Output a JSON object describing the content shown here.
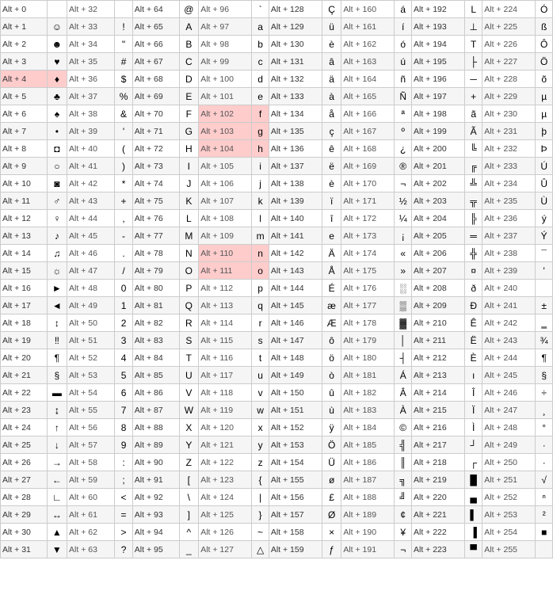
{
  "table": {
    "columns": 8,
    "rows": [
      [
        {
          "code": "Alt + 0",
          "sym": "",
          "alt": "Alt + 32",
          "sym2": " "
        },
        {
          "code": "Alt + 64",
          "sym": "@",
          "alt": "Alt + 96",
          "sym2": "`"
        },
        {
          "code": "Alt + 128",
          "sym": "Ç",
          "alt": "Alt + 160",
          "sym2": "á"
        },
        {
          "code": "Alt + 192",
          "sym": "L",
          "alt": "Alt + 224",
          "sym2": "Ó"
        }
      ],
      [
        {
          "code": "Alt + 1",
          "sym": "☺",
          "alt": "Alt + 33",
          "sym2": "!"
        },
        {
          "code": "Alt + 65",
          "sym": "A",
          "alt": "Alt + 97",
          "sym2": "a"
        },
        {
          "code": "Alt + 129",
          "sym": "ü",
          "alt": "Alt + 161",
          "sym2": "í"
        },
        {
          "code": "Alt + 193",
          "sym": "⊥",
          "alt": "Alt + 225",
          "sym2": "ß"
        }
      ],
      [
        {
          "code": "Alt + 2",
          "sym": "☻",
          "alt": "Alt + 34",
          "sym2": "\""
        },
        {
          "code": "Alt + 66",
          "sym": "B",
          "alt": "Alt + 98",
          "sym2": "b"
        },
        {
          "code": "Alt + 130",
          "sym": "è",
          "alt": "Alt + 162",
          "sym2": "ó"
        },
        {
          "code": "Alt + 194",
          "sym": "T",
          "alt": "Alt + 226",
          "sym2": "Ô"
        }
      ],
      [
        {
          "code": "Alt + 3",
          "sym": "♥",
          "alt": "Alt + 35",
          "sym2": "#"
        },
        {
          "code": "Alt + 67",
          "sym": "C",
          "alt": "Alt + 99",
          "sym2": "c"
        },
        {
          "code": "Alt + 131",
          "sym": "â",
          "alt": "Alt + 163",
          "sym2": "ú"
        },
        {
          "code": "Alt + 195",
          "sym": "├",
          "alt": "Alt + 227",
          "sym2": "Ö"
        }
      ],
      [
        {
          "code": "Alt + 4",
          "sym": "♦",
          "alt": "Alt + 36",
          "sym2": "$"
        },
        {
          "code": "Alt + 68",
          "sym": "D",
          "alt": "Alt + 100",
          "sym2": "d"
        },
        {
          "code": "Alt + 132",
          "sym": "ä",
          "alt": "Alt + 164",
          "sym2": "ñ"
        },
        {
          "code": "Alt + 196",
          "sym": "─",
          "alt": "Alt + 228",
          "sym2": "õ"
        }
      ],
      [
        {
          "code": "Alt + 5",
          "sym": "♣",
          "alt": "Alt + 37",
          "sym2": "%"
        },
        {
          "code": "Alt + 69",
          "sym": "E",
          "alt": "Alt + 101",
          "sym2": "e"
        },
        {
          "code": "Alt + 133",
          "sym": "à",
          "alt": "Alt + 165",
          "sym2": "Ñ"
        },
        {
          "code": "Alt + 197",
          "sym": "+",
          "alt": "Alt + 229",
          "sym2": "µ"
        }
      ],
      [
        {
          "code": "Alt + 6",
          "sym": "♠",
          "alt": "Alt + 38",
          "sym2": "&"
        },
        {
          "code": "Alt + 70",
          "sym": "F",
          "alt": "Alt + 102",
          "sym2": "f"
        },
        {
          "code": "Alt + 134",
          "sym": "å",
          "alt": "Alt + 166",
          "sym2": "ª"
        },
        {
          "code": "Alt + 198",
          "sym": "ã",
          "alt": "Alt + 230",
          "sym2": "µ"
        }
      ],
      [
        {
          "code": "Alt + 7",
          "sym": "•",
          "alt": "Alt + 39",
          "sym2": "'"
        },
        {
          "code": "Alt + 71",
          "sym": "G",
          "alt": "Alt + 103",
          "sym2": "g"
        },
        {
          "code": "Alt + 135",
          "sym": "ç",
          "alt": "Alt + 167",
          "sym2": "º"
        },
        {
          "code": "Alt + 199",
          "sym": "Ã",
          "alt": "Alt + 231",
          "sym2": "þ"
        }
      ],
      [
        {
          "code": "Alt + 8",
          "sym": "◘",
          "alt": "Alt + 40",
          "sym2": "("
        },
        {
          "code": "Alt + 72",
          "sym": "H",
          "alt": "Alt + 104",
          "sym2": "h"
        },
        {
          "code": "Alt + 136",
          "sym": "ê",
          "alt": "Alt + 168",
          "sym2": "¿"
        },
        {
          "code": "Alt + 200",
          "sym": "╚",
          "alt": "Alt + 232",
          "sym2": "Þ"
        }
      ],
      [
        {
          "code": "Alt + 9",
          "sym": "○",
          "alt": "Alt + 41",
          "sym2": ")"
        },
        {
          "code": "Alt + 73",
          "sym": "I",
          "alt": "Alt + 105",
          "sym2": "i"
        },
        {
          "code": "Alt + 137",
          "sym": "ë",
          "alt": "Alt + 169",
          "sym2": "®"
        },
        {
          "code": "Alt + 201",
          "sym": "╔",
          "alt": "Alt + 233",
          "sym2": "Ú"
        }
      ],
      [
        {
          "code": "Alt + 10",
          "sym": "◙",
          "alt": "Alt + 42",
          "sym2": "*"
        },
        {
          "code": "Alt + 74",
          "sym": "J",
          "alt": "Alt + 106",
          "sym2": "j"
        },
        {
          "code": "Alt + 138",
          "sym": "è",
          "alt": "Alt + 170",
          "sym2": "¬"
        },
        {
          "code": "Alt + 202",
          "sym": "╩",
          "alt": "Alt + 234",
          "sym2": "Û"
        }
      ],
      [
        {
          "code": "Alt + 11",
          "sym": "♂",
          "alt": "Alt + 43",
          "sym2": "+"
        },
        {
          "code": "Alt + 75",
          "sym": "K",
          "alt": "Alt + 107",
          "sym2": "k"
        },
        {
          "code": "Alt + 139",
          "sym": "ï",
          "alt": "Alt + 171",
          "sym2": "½"
        },
        {
          "code": "Alt + 203",
          "sym": "╦",
          "alt": "Alt + 235",
          "sym2": "Ù"
        }
      ],
      [
        {
          "code": "Alt + 12",
          "sym": "♀",
          "alt": "Alt + 44",
          "sym2": ","
        },
        {
          "code": "Alt + 76",
          "sym": "L",
          "alt": "Alt + 108",
          "sym2": "l"
        },
        {
          "code": "Alt + 140",
          "sym": "î",
          "alt": "Alt + 172",
          "sym2": "¼"
        },
        {
          "code": "Alt + 204",
          "sym": "╠",
          "alt": "Alt + 236",
          "sym2": "ý"
        }
      ],
      [
        {
          "code": "Alt + 13",
          "sym": "♪",
          "alt": "Alt + 45",
          "sym2": "-"
        },
        {
          "code": "Alt + 77",
          "sym": "M",
          "alt": "Alt + 109",
          "sym2": "m"
        },
        {
          "code": "Alt + 141",
          "sym": "e",
          "alt": "Alt + 173",
          "sym2": "¡"
        },
        {
          "code": "Alt + 205",
          "sym": "═",
          "alt": "Alt + 237",
          "sym2": "Ý"
        }
      ],
      [
        {
          "code": "Alt + 14",
          "sym": "♫",
          "alt": "Alt + 46",
          "sym2": "."
        },
        {
          "code": "Alt + 78",
          "sym": "N",
          "alt": "Alt + 110",
          "sym2": "n"
        },
        {
          "code": "Alt + 142",
          "sym": "Ä",
          "alt": "Alt + 174",
          "sym2": "«"
        },
        {
          "code": "Alt + 206",
          "sym": "╬",
          "alt": "Alt + 238",
          "sym2": "¯"
        }
      ],
      [
        {
          "code": "Alt + 15",
          "sym": "☼",
          "alt": "Alt + 47",
          "sym2": "/"
        },
        {
          "code": "Alt + 79",
          "sym": "O",
          "alt": "Alt + 111",
          "sym2": "o"
        },
        {
          "code": "Alt + 143",
          "sym": "Å",
          "alt": "Alt + 175",
          "sym2": "»"
        },
        {
          "code": "Alt + 207",
          "sym": "¤",
          "alt": "Alt + 239",
          "sym2": "'"
        }
      ],
      [
        {
          "code": "Alt + 16",
          "sym": "►",
          "alt": "Alt + 48",
          "sym2": "0"
        },
        {
          "code": "Alt + 80",
          "sym": "P",
          "alt": "Alt + 112",
          "sym2": "p"
        },
        {
          "code": "Alt + 144",
          "sym": "É",
          "alt": "Alt + 176",
          "sym2": "░"
        },
        {
          "code": "Alt + 208",
          "sym": "ð",
          "alt": "Alt + 240",
          "sym2": "­"
        }
      ],
      [
        {
          "code": "Alt + 17",
          "sym": "◄",
          "alt": "Alt + 49",
          "sym2": "1"
        },
        {
          "code": "Alt + 81",
          "sym": "Q",
          "alt": "Alt + 113",
          "sym2": "q"
        },
        {
          "code": "Alt + 145",
          "sym": "æ",
          "alt": "Alt + 177",
          "sym2": "▒"
        },
        {
          "code": "Alt + 209",
          "sym": "Ð",
          "alt": "Alt + 241",
          "sym2": "±"
        }
      ],
      [
        {
          "code": "Alt + 18",
          "sym": "↕",
          "alt": "Alt + 50",
          "sym2": "2"
        },
        {
          "code": "Alt + 82",
          "sym": "R",
          "alt": "Alt + 114",
          "sym2": "r"
        },
        {
          "code": "Alt + 146",
          "sym": "Æ",
          "alt": "Alt + 178",
          "sym2": "▓"
        },
        {
          "code": "Alt + 210",
          "sym": "Ê",
          "alt": "Alt + 242",
          "sym2": "‗"
        }
      ],
      [
        {
          "code": "Alt + 19",
          "sym": "‼",
          "alt": "Alt + 51",
          "sym2": "3"
        },
        {
          "code": "Alt + 83",
          "sym": "S",
          "alt": "Alt + 115",
          "sym2": "s"
        },
        {
          "code": "Alt + 147",
          "sym": "ô",
          "alt": "Alt + 179",
          "sym2": "│"
        },
        {
          "code": "Alt + 211",
          "sym": "Ë",
          "alt": "Alt + 243",
          "sym2": "¾"
        }
      ],
      [
        {
          "code": "Alt + 20",
          "sym": "¶",
          "alt": "Alt + 52",
          "sym2": "4"
        },
        {
          "code": "Alt + 84",
          "sym": "T",
          "alt": "Alt + 116",
          "sym2": "t"
        },
        {
          "code": "Alt + 148",
          "sym": "ö",
          "alt": "Alt + 180",
          "sym2": "┤"
        },
        {
          "code": "Alt + 212",
          "sym": "È",
          "alt": "Alt + 244",
          "sym2": "¶"
        }
      ],
      [
        {
          "code": "Alt + 21",
          "sym": "§",
          "alt": "Alt + 53",
          "sym2": "5"
        },
        {
          "code": "Alt + 85",
          "sym": "U",
          "alt": "Alt + 117",
          "sym2": "u"
        },
        {
          "code": "Alt + 149",
          "sym": "ò",
          "alt": "Alt + 181",
          "sym2": "Á"
        },
        {
          "code": "Alt + 213",
          "sym": "ı",
          "alt": "Alt + 245",
          "sym2": "§"
        }
      ],
      [
        {
          "code": "Alt + 22",
          "sym": "▬",
          "alt": "Alt + 54",
          "sym2": "6"
        },
        {
          "code": "Alt + 86",
          "sym": "V",
          "alt": "Alt + 118",
          "sym2": "v"
        },
        {
          "code": "Alt + 150",
          "sym": "û",
          "alt": "Alt + 182",
          "sym2": "Â"
        },
        {
          "code": "Alt + 214",
          "sym": "Î",
          "alt": "Alt + 246",
          "sym2": "÷"
        }
      ],
      [
        {
          "code": "Alt + 23",
          "sym": "↨",
          "alt": "Alt + 55",
          "sym2": "7"
        },
        {
          "code": "Alt + 87",
          "sym": "W",
          "alt": "Alt + 119",
          "sym2": "w"
        },
        {
          "code": "Alt + 151",
          "sym": "ù",
          "alt": "Alt + 183",
          "sym2": "À"
        },
        {
          "code": "Alt + 215",
          "sym": "Ï",
          "alt": "Alt + 247",
          "sym2": "¸"
        }
      ],
      [
        {
          "code": "Alt + 24",
          "sym": "↑",
          "alt": "Alt + 56",
          "sym2": "8"
        },
        {
          "code": "Alt + 88",
          "sym": "X",
          "alt": "Alt + 120",
          "sym2": "x"
        },
        {
          "code": "Alt + 152",
          "sym": "ÿ",
          "alt": "Alt + 184",
          "sym2": "©"
        },
        {
          "code": "Alt + 216",
          "sym": "Ì",
          "alt": "Alt + 248",
          "sym2": "°"
        }
      ],
      [
        {
          "code": "Alt + 25",
          "sym": "↓",
          "alt": "Alt + 57",
          "sym2": "9"
        },
        {
          "code": "Alt + 89",
          "sym": "Y",
          "alt": "Alt + 121",
          "sym2": "y"
        },
        {
          "code": "Alt + 153",
          "sym": "Ö",
          "alt": "Alt + 185",
          "sym2": "╣"
        },
        {
          "code": "Alt + 217",
          "sym": "┘",
          "alt": "Alt + 249",
          "sym2": "·"
        }
      ],
      [
        {
          "code": "Alt + 26",
          "sym": "→",
          "alt": "Alt + 58",
          "sym2": ":"
        },
        {
          "code": "Alt + 90",
          "sym": "Z",
          "alt": "Alt + 122",
          "sym2": "z"
        },
        {
          "code": "Alt + 154",
          "sym": "Ü",
          "alt": "Alt + 186",
          "sym2": "║"
        },
        {
          "code": "Alt + 218",
          "sym": "┌",
          "alt": "Alt + 250",
          "sym2": "·"
        }
      ],
      [
        {
          "code": "Alt + 27",
          "sym": "←",
          "alt": "Alt + 59",
          "sym2": ";"
        },
        {
          "code": "Alt + 91",
          "sym": "[",
          "alt": "Alt + 123",
          "sym2": "{"
        },
        {
          "code": "Alt + 155",
          "sym": "ø",
          "alt": "Alt + 187",
          "sym2": "╗"
        },
        {
          "code": "Alt + 219",
          "sym": "█",
          "alt": "Alt + 251",
          "sym2": "√"
        }
      ],
      [
        {
          "code": "Alt + 28",
          "sym": "∟",
          "alt": "Alt + 60",
          "sym2": "<"
        },
        {
          "code": "Alt + 92",
          "sym": "\\",
          "alt": "Alt + 124",
          "sym2": "|"
        },
        {
          "code": "Alt + 156",
          "sym": "£",
          "alt": "Alt + 188",
          "sym2": "╝"
        },
        {
          "code": "Alt + 220",
          "sym": "▄",
          "alt": "Alt + 252",
          "sym2": "ⁿ"
        }
      ],
      [
        {
          "code": "Alt + 29",
          "sym": "↔",
          "alt": "Alt + 61",
          "sym2": "="
        },
        {
          "code": "Alt + 93",
          "sym": "]",
          "alt": "Alt + 125",
          "sym2": "}"
        },
        {
          "code": "Alt + 157",
          "sym": "Ø",
          "alt": "Alt + 189",
          "sym2": "¢"
        },
        {
          "code": "Alt + 221",
          "sym": "▌",
          "alt": "Alt + 253",
          "sym2": "²"
        }
      ],
      [
        {
          "code": "Alt + 30",
          "sym": "▲",
          "alt": "Alt + 62",
          "sym2": ">"
        },
        {
          "code": "Alt + 94",
          "sym": "^",
          "alt": "Alt + 126",
          "sym2": "~"
        },
        {
          "code": "Alt + 158",
          "sym": "×",
          "alt": "Alt + 190",
          "sym2": "¥"
        },
        {
          "code": "Alt + 222",
          "sym": "▐",
          "alt": "Alt + 254",
          "sym2": "■"
        }
      ],
      [
        {
          "code": "Alt + 31",
          "sym": "▼",
          "alt": "Alt + 63",
          "sym2": "?"
        },
        {
          "code": "Alt + 95",
          "sym": "_",
          "alt": "Alt + 127",
          "sym2": "△"
        },
        {
          "code": "Alt + 159",
          "sym": "ƒ",
          "alt": "Alt + 191",
          "sym2": "¬"
        },
        {
          "code": "Alt + 223",
          "sym": "▀",
          "alt": "Alt + 255",
          "sym2": " "
        }
      ]
    ],
    "highlights": {
      "row4_col0": true,
      "row6_col1": true,
      "row7_col1": true,
      "row8_col1": true,
      "row14_col1": true,
      "row15_col1": true
    }
  }
}
